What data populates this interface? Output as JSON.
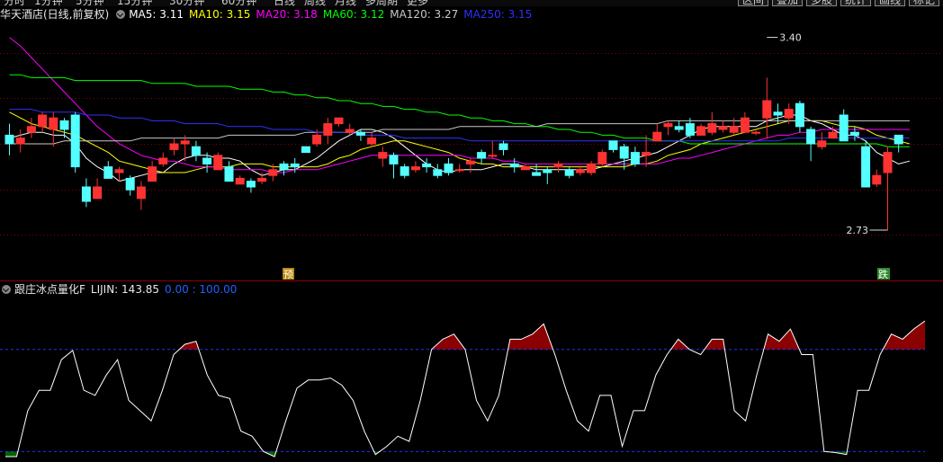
{
  "top_menu": {
    "items": [
      "分时",
      "1分钟",
      "5分钟",
      "15分钟",
      "30分钟",
      "60分钟",
      "日线",
      "周线",
      "月线",
      "多周期",
      "更多"
    ],
    "right_buttons": [
      "区间",
      "叠加",
      "多股",
      "统计",
      "画线",
      "标记"
    ]
  },
  "main_header": {
    "title": "华天酒店(日线,前复权)",
    "ma": [
      {
        "label": "MA5: 3.11",
        "color": "#ffffff"
      },
      {
        "label": "MA10: 3.15",
        "color": "#ffff00"
      },
      {
        "label": "MA20: 3.18",
        "color": "#ff00ff"
      },
      {
        "label": "MA60: 3.12",
        "color": "#00ff00"
      },
      {
        "label": "MA120: 3.27",
        "color": "#c8c8c8"
      },
      {
        "label": "MA250: 3.15",
        "color": "#3030ff"
      }
    ]
  },
  "annotations": {
    "high": "3.40",
    "low": "2.73",
    "signal_yu": "预",
    "signal_die": "跌"
  },
  "indicator_header": {
    "name": "跟庄冰点量化F",
    "value": "LIJIN: 143.85",
    "range": "0.00 : 100.00"
  },
  "colors": {
    "up": "#ff3232",
    "down": "#54ffff",
    "bear_fill": "#8b0000",
    "bull_fill": "#006400",
    "grid": "#8b0000"
  },
  "chart_data": [
    {
      "type": "candlestick",
      "title": "华天酒店(日线,前复权)",
      "y_high": 3.4,
      "y_low": 2.73,
      "candles": [
        [
          3.06,
          3.03,
          3.1,
          2.99
        ],
        [
          3.03,
          3.05,
          3.08,
          3.0
        ],
        [
          3.07,
          3.09,
          3.12,
          3.05
        ],
        [
          3.09,
          3.13,
          3.14,
          3.07
        ],
        [
          3.08,
          3.12,
          3.14,
          3.02
        ],
        [
          3.11,
          3.08,
          3.12,
          3.05
        ],
        [
          3.13,
          2.95,
          3.14,
          2.93
        ],
        [
          2.88,
          2.83,
          2.91,
          2.81
        ],
        [
          2.84,
          2.88,
          2.91,
          2.84
        ],
        [
          2.95,
          2.91,
          2.97,
          2.91
        ],
        [
          2.93,
          2.94,
          2.95,
          2.9
        ],
        [
          2.91,
          2.87,
          2.92,
          2.85
        ],
        [
          2.84,
          2.88,
          2.9,
          2.8
        ],
        [
          2.9,
          2.95,
          2.97,
          2.9
        ],
        [
          2.96,
          2.98,
          3.0,
          2.95
        ],
        [
          3.01,
          3.03,
          3.05,
          2.99
        ],
        [
          3.03,
          3.04,
          3.06,
          2.97
        ],
        [
          3.02,
          2.99,
          3.04,
          2.97
        ],
        [
          2.98,
          2.96,
          3.0,
          2.93
        ],
        [
          2.94,
          2.99,
          3.0,
          2.94
        ],
        [
          2.95,
          2.9,
          2.97,
          2.9
        ],
        [
          2.89,
          2.91,
          2.92,
          2.89
        ],
        [
          2.9,
          2.88,
          2.91,
          2.86
        ],
        [
          2.9,
          2.91,
          2.93,
          2.89
        ],
        [
          2.92,
          2.94,
          2.96,
          2.9
        ],
        [
          2.96,
          2.94,
          2.97,
          2.92
        ],
        [
          2.96,
          2.95,
          2.98,
          2.93
        ],
        [
          3.02,
          3.0,
          3.02,
          3.0
        ],
        [
          3.03,
          3.06,
          3.08,
          3.02
        ],
        [
          3.06,
          3.1,
          3.12,
          3.03
        ],
        [
          3.1,
          3.12,
          3.12,
          3.09
        ],
        [
          3.07,
          3.08,
          3.1,
          3.06
        ],
        [
          3.07,
          3.06,
          3.08,
          3.04
        ],
        [
          3.03,
          3.05,
          3.07,
          3.02
        ],
        [
          2.98,
          3.0,
          3.02,
          2.95
        ],
        [
          2.99,
          2.96,
          3.0,
          2.91
        ],
        [
          2.95,
          2.92,
          2.96,
          2.91
        ],
        [
          2.94,
          2.95,
          2.97,
          2.93
        ],
        [
          2.96,
          2.95,
          2.98,
          2.93
        ],
        [
          2.94,
          2.92,
          2.96,
          2.91
        ],
        [
          2.96,
          2.93,
          2.98,
          2.92
        ],
        [
          2.94,
          2.94,
          2.96,
          2.93
        ],
        [
          2.96,
          2.97,
          2.98,
          2.93
        ],
        [
          3.0,
          2.98,
          3.01,
          2.96
        ],
        [
          2.99,
          2.99,
          3.04,
          2.98
        ],
        [
          3.03,
          3.01,
          3.04,
          2.99
        ],
        [
          2.96,
          2.95,
          2.98,
          2.93
        ],
        [
          2.94,
          2.95,
          2.96,
          2.94
        ],
        [
          2.93,
          2.92,
          2.96,
          2.92
        ],
        [
          2.94,
          2.93,
          2.95,
          2.89
        ],
        [
          2.95,
          2.96,
          2.97,
          2.93
        ],
        [
          2.94,
          2.92,
          2.95,
          2.91
        ],
        [
          2.93,
          2.94,
          2.95,
          2.92
        ],
        [
          2.93,
          2.96,
          2.97,
          2.92
        ],
        [
          2.96,
          3.0,
          3.01,
          2.95
        ],
        [
          3.04,
          3.01,
          3.04,
          3.0
        ],
        [
          3.02,
          2.98,
          3.03,
          2.94
        ],
        [
          3.0,
          2.96,
          3.02,
          2.95
        ],
        [
          2.99,
          3.0,
          3.06,
          2.95
        ],
        [
          3.04,
          3.07,
          3.1,
          3.04
        ],
        [
          3.09,
          3.1,
          3.11,
          3.06
        ],
        [
          3.09,
          3.08,
          3.11,
          3.07
        ],
        [
          3.1,
          3.06,
          3.12,
          3.05
        ],
        [
          3.06,
          3.09,
          3.1,
          3.06
        ],
        [
          3.07,
          3.1,
          3.14,
          3.06
        ],
        [
          3.08,
          3.09,
          3.11,
          3.07
        ],
        [
          3.07,
          3.09,
          3.12,
          3.06
        ],
        [
          3.07,
          3.12,
          3.14,
          3.07
        ],
        [
          3.07,
          3.07,
          3.08,
          3.06
        ],
        [
          3.12,
          3.18,
          3.26,
          3.05
        ],
        [
          3.14,
          3.13,
          3.17,
          3.1
        ],
        [
          3.12,
          3.15,
          3.17,
          3.1
        ],
        [
          3.17,
          3.09,
          3.18,
          3.07
        ],
        [
          3.08,
          3.03,
          3.09,
          2.97
        ],
        [
          3.02,
          3.04,
          3.07,
          3.01
        ],
        [
          3.05,
          3.07,
          3.09,
          3.05
        ],
        [
          3.13,
          3.04,
          3.15,
          3.04
        ],
        [
          3.07,
          3.06,
          3.09,
          3.04
        ],
        [
          3.02,
          2.88,
          3.04,
          2.88
        ],
        [
          2.89,
          2.92,
          2.94,
          2.88
        ],
        [
          2.93,
          3.0,
          3.02,
          2.73
        ],
        [
          3.06,
          3.03,
          3.06,
          3.0
        ]
      ],
      "ma": [
        {
          "name": "MA5",
          "color": "#ffffff",
          "values": [
            3.05,
            3.06,
            3.07,
            3.07,
            3.06,
            3.06,
            3.03,
            2.98,
            2.95,
            2.93,
            2.9,
            2.91,
            2.92,
            2.93,
            2.93,
            2.96,
            2.98,
            2.99,
            2.99,
            2.98,
            2.98,
            2.97,
            2.94,
            2.92,
            2.93,
            2.94,
            2.94,
            2.96,
            2.98,
            3.01,
            3.04,
            3.06,
            3.08,
            3.08,
            3.07,
            3.05,
            3.02,
            2.99,
            2.96,
            2.94,
            2.93,
            2.94,
            2.94,
            2.94,
            2.95,
            2.96,
            2.96,
            2.95,
            2.94,
            2.94,
            2.94,
            2.94,
            2.94,
            2.94,
            2.95,
            2.96,
            2.97,
            2.98,
            2.99,
            3.0,
            3.02,
            3.04,
            3.06,
            3.08,
            3.09,
            3.09,
            3.09,
            3.09,
            3.09,
            3.11,
            3.12,
            3.13,
            3.13,
            3.11,
            3.1,
            3.08,
            3.06,
            3.06,
            3.04,
            3.0,
            2.98,
            2.96,
            2.97
          ]
        },
        {
          "name": "MA10",
          "color": "#ffff00",
          "values": [
            3.14,
            3.12,
            3.1,
            3.09,
            3.08,
            3.07,
            3.06,
            3.04,
            3.02,
            3.0,
            2.97,
            2.96,
            2.95,
            2.94,
            2.93,
            2.93,
            2.93,
            2.94,
            2.95,
            2.95,
            2.95,
            2.96,
            2.96,
            2.96,
            2.95,
            2.95,
            2.95,
            2.95,
            2.95,
            2.96,
            2.98,
            2.99,
            3.01,
            3.02,
            3.03,
            3.04,
            3.04,
            3.03,
            3.02,
            3.01,
            3.0,
            2.98,
            2.97,
            2.96,
            2.96,
            2.95,
            2.95,
            2.95,
            2.95,
            2.95,
            2.95,
            2.95,
            2.95,
            2.95,
            2.95,
            2.95,
            2.95,
            2.96,
            2.96,
            2.97,
            2.99,
            3.0,
            3.01,
            3.03,
            3.04,
            3.05,
            3.06,
            3.07,
            3.08,
            3.09,
            3.1,
            3.11,
            3.11,
            3.11,
            3.11,
            3.1,
            3.09,
            3.09,
            3.08,
            3.06,
            3.05,
            3.04,
            3.03
          ]
        },
        {
          "name": "MA20",
          "color": "#ff00ff",
          "values": [
            3.4,
            3.37,
            3.33,
            3.29,
            3.25,
            3.21,
            3.17,
            3.13,
            3.09,
            3.06,
            3.03,
            3.01,
            2.99,
            2.98,
            2.97,
            2.97,
            2.96,
            2.95,
            2.95,
            2.95,
            2.94,
            2.94,
            2.94,
            2.94,
            2.93,
            2.93,
            2.94,
            2.94,
            2.94,
            2.95,
            2.96,
            2.97,
            2.98,
            2.99,
            2.99,
            2.99,
            2.99,
            2.99,
            2.99,
            2.99,
            2.99,
            2.99,
            2.98,
            2.98,
            2.98,
            2.97,
            2.97,
            2.96,
            2.96,
            2.96,
            2.96,
            2.96,
            2.96,
            2.96,
            2.96,
            2.96,
            2.96,
            2.96,
            2.96,
            2.96,
            2.97,
            2.98,
            2.98,
            2.99,
            3.0,
            3.01,
            3.02,
            3.03,
            3.04,
            3.05,
            3.06,
            3.06,
            3.07,
            3.07,
            3.08,
            3.08,
            3.08,
            3.08,
            3.08,
            3.08,
            3.08,
            3.08,
            3.08
          ]
        },
        {
          "name": "MA60",
          "color": "#00ff00",
          "values": [
            3.27,
            3.27,
            3.26,
            3.26,
            3.26,
            3.26,
            3.25,
            3.25,
            3.25,
            3.25,
            3.25,
            3.25,
            3.25,
            3.24,
            3.24,
            3.24,
            3.24,
            3.23,
            3.23,
            3.23,
            3.23,
            3.22,
            3.22,
            3.22,
            3.21,
            3.21,
            3.2,
            3.2,
            3.19,
            3.19,
            3.18,
            3.18,
            3.17,
            3.17,
            3.16,
            3.16,
            3.15,
            3.15,
            3.14,
            3.14,
            3.13,
            3.13,
            3.12,
            3.12,
            3.11,
            3.11,
            3.1,
            3.1,
            3.09,
            3.09,
            3.08,
            3.08,
            3.07,
            3.07,
            3.06,
            3.06,
            3.05,
            3.05,
            3.05,
            3.04,
            3.04,
            3.04,
            3.03,
            3.03,
            3.03,
            3.03,
            3.03,
            3.03,
            3.03,
            3.03,
            3.03,
            3.03,
            3.03,
            3.03,
            3.03,
            3.03,
            3.03,
            3.03,
            3.03,
            3.03,
            3.02,
            3.02,
            3.02
          ]
        },
        {
          "name": "MA120",
          "color": "#c8c8c8",
          "values": [
            3.03,
            3.03,
            3.03,
            3.03,
            3.03,
            3.04,
            3.04,
            3.04,
            3.04,
            3.04,
            3.04,
            3.04,
            3.05,
            3.05,
            3.05,
            3.05,
            3.05,
            3.05,
            3.05,
            3.05,
            3.06,
            3.06,
            3.06,
            3.06,
            3.06,
            3.06,
            3.06,
            3.07,
            3.07,
            3.07,
            3.07,
            3.07,
            3.07,
            3.07,
            3.08,
            3.08,
            3.08,
            3.08,
            3.08,
            3.08,
            3.08,
            3.09,
            3.09,
            3.09,
            3.09,
            3.09,
            3.09,
            3.09,
            3.09,
            3.1,
            3.1,
            3.1,
            3.1,
            3.1,
            3.1,
            3.1,
            3.1,
            3.1,
            3.1,
            3.1,
            3.11,
            3.11,
            3.11,
            3.11,
            3.11,
            3.11,
            3.11,
            3.11,
            3.11,
            3.11,
            3.11,
            3.11,
            3.11,
            3.11,
            3.11,
            3.11,
            3.11,
            3.11,
            3.11,
            3.11,
            3.11,
            3.11,
            3.11
          ]
        },
        {
          "name": "MA250",
          "color": "#3030ff",
          "values": [
            3.15,
            3.15,
            3.15,
            3.14,
            3.14,
            3.14,
            3.14,
            3.13,
            3.13,
            3.13,
            3.12,
            3.12,
            3.12,
            3.11,
            3.11,
            3.11,
            3.1,
            3.1,
            3.1,
            3.1,
            3.09,
            3.09,
            3.09,
            3.09,
            3.08,
            3.08,
            3.08,
            3.08,
            3.07,
            3.07,
            3.07,
            3.07,
            3.06,
            3.06,
            3.06,
            3.06,
            3.05,
            3.05,
            3.05,
            3.05,
            3.05,
            3.05,
            3.04,
            3.04,
            3.04,
            3.04,
            3.04,
            3.04,
            3.04,
            3.04,
            3.04,
            3.04,
            3.04,
            3.04,
            3.04,
            3.04,
            3.04,
            3.04,
            3.04,
            3.04,
            3.04,
            3.04,
            3.04,
            3.04,
            3.04,
            3.04,
            3.04,
            3.04,
            3.04,
            3.04,
            3.04,
            3.05,
            3.05,
            3.05,
            3.05,
            3.05,
            3.05,
            3.05,
            3.05,
            3.05,
            3.05,
            3.05,
            3.05
          ]
        }
      ]
    },
    {
      "type": "line",
      "name": "LIJIN",
      "ylim": [
        -5,
        150
      ],
      "levels": [
        100,
        0
      ],
      "values": [
        -5,
        -5,
        40,
        60,
        60,
        90,
        99,
        60,
        55,
        75,
        90,
        50,
        40,
        30,
        60,
        95,
        105,
        108,
        75,
        55,
        52,
        20,
        15,
        0,
        -5,
        30,
        62,
        70,
        70,
        72,
        65,
        50,
        20,
        -3,
        5,
        15,
        10,
        50,
        100,
        110,
        115,
        100,
        50,
        30,
        55,
        110,
        110,
        115,
        125,
        95,
        60,
        30,
        20,
        55,
        55,
        5,
        40,
        40,
        75,
        95,
        110,
        100,
        95,
        110,
        110,
        40,
        30,
        75,
        115,
        108,
        120,
        95,
        95,
        0,
        -1,
        -3,
        60,
        60,
        95,
        115,
        110,
        120,
        128
      ]
    }
  ]
}
